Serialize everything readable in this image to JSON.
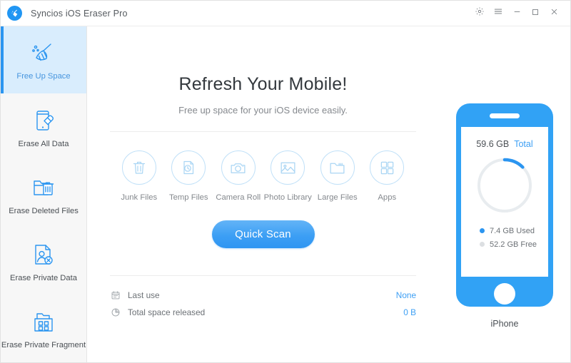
{
  "window": {
    "title": "Syncios iOS Eraser Pro",
    "logo_icon": "broom-logo-icon",
    "controls": [
      {
        "name": "settings-button",
        "icon": "gear-icon",
        "label": ""
      },
      {
        "name": "menu-button",
        "icon": "hamburger-menu-icon",
        "label": ""
      },
      {
        "name": "minimize-button",
        "icon": "minimize-icon",
        "label": ""
      },
      {
        "name": "maximize-button",
        "icon": "maximize-icon",
        "label": ""
      },
      {
        "name": "close-button",
        "icon": "close-icon",
        "label": ""
      }
    ]
  },
  "sidebar": {
    "items": [
      {
        "label": "Free Up Space",
        "icon": "broom-icon",
        "active": true
      },
      {
        "label": "Erase All Data",
        "icon": "phone-eraser-icon",
        "active": false
      },
      {
        "label": "Erase Deleted Files",
        "icon": "folder-trash-icon",
        "active": false
      },
      {
        "label": "Erase Private Data",
        "icon": "document-user-delete-icon",
        "active": false
      },
      {
        "label": "Erase Private Fragment",
        "icon": "folder-grid-icon",
        "active": false
      }
    ]
  },
  "main": {
    "heading": "Refresh Your Mobile!",
    "subheading": "Free up space for your iOS device easily.",
    "categories": [
      {
        "label": "Junk Files",
        "icon": "trash-icon"
      },
      {
        "label": "Temp Files",
        "icon": "document-clock-icon"
      },
      {
        "label": "Camera Roll",
        "icon": "camera-icon"
      },
      {
        "label": "Photo Library",
        "icon": "photo-icon"
      },
      {
        "label": "Large Files",
        "icon": "folder-icon"
      },
      {
        "label": "Apps",
        "icon": "grid-apps-icon"
      }
    ],
    "scan_button": "Quick Scan",
    "stats": [
      {
        "label": "Last use",
        "value": "None",
        "icon": "calendar-icon"
      },
      {
        "label": "Total space released",
        "value": "0 B",
        "icon": "pie-chart-icon"
      }
    ]
  },
  "device": {
    "total_size": "59.6 GB",
    "total_word": "Total",
    "used_label": "7.4 GB Used",
    "free_label": "52.2 GB Free",
    "name": "iPhone",
    "used_percent": 12.4
  },
  "colors": {
    "accent": "#3d9ff4",
    "phone_blue": "#31a2f5",
    "active_bg": "#d9edfd",
    "active_bar": "#2b95f0",
    "ring_track": "#e8ecef"
  }
}
